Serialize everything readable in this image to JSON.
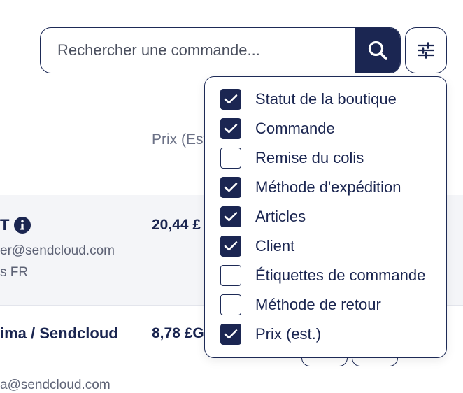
{
  "search": {
    "placeholder": "Rechercher une commande..."
  },
  "table": {
    "price_header": "Prix (Est",
    "rows": [
      {
        "name": "T",
        "email": "er@sendcloud.com",
        "sub": "s FR",
        "price": "20,44 £"
      },
      {
        "name": "ima / Sendcloud",
        "email": "a@sendcloud.com",
        "price": "8,78 £G"
      }
    ]
  },
  "column_menu": {
    "options": [
      {
        "label": "Statut de la boutique",
        "checked": true
      },
      {
        "label": "Commande",
        "checked": true
      },
      {
        "label": "Remise du colis",
        "checked": false
      },
      {
        "label": "Méthode d'expédition",
        "checked": true
      },
      {
        "label": "Articles",
        "checked": true
      },
      {
        "label": "Client",
        "checked": true
      },
      {
        "label": "Étiquettes de commande",
        "checked": false
      },
      {
        "label": "Méthode de retour",
        "checked": false
      },
      {
        "label": "Prix (est.)",
        "checked": true
      }
    ]
  },
  "icons": {
    "search": "search-icon",
    "filter": "sliders-icon",
    "info": "info-icon",
    "check": "check-icon"
  },
  "colors": {
    "primary": "#1b2652",
    "row_bg": "#f4f5f8",
    "muted": "#5d6275"
  }
}
